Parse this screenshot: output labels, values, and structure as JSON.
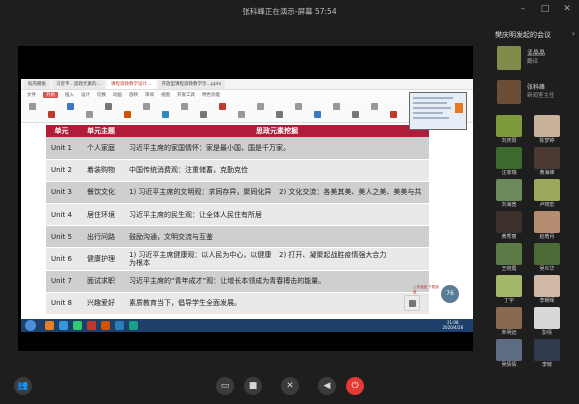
{
  "window": {
    "title": "张科峰正在演示-屏幕 57:54",
    "controls": [
      "minimize-icon",
      "maximize-icon",
      "close-icon"
    ]
  },
  "shared_screen": {
    "tabs": [
      {
        "label": "稻壳模板",
        "active": false
      },
      {
        "label": "习近平…思政元素的…",
        "active": false
      },
      {
        "label": "课程思政教学设计…",
        "active": true
      },
      {
        "label": "开放型课程思政教学示…pptx",
        "active": false
      }
    ],
    "menu": [
      "文件",
      "开始",
      "插入",
      "设计",
      "切换",
      "动画",
      "放映",
      "审阅",
      "视图",
      "开发工具",
      "特色功能"
    ],
    "active_menu": "开始",
    "table": {
      "headers": [
        "单元",
        "单元主题",
        "思政元素挖掘"
      ],
      "rows": [
        {
          "unit": "Unit 1",
          "topic": "个人家庭",
          "content": "习近平主席的家国情怀：家是最小国，国是千万家。",
          "content2": ""
        },
        {
          "unit": "Unit 2",
          "topic": "着装购物",
          "content": "中国传统消费观：注重储蓄，克勤克俭",
          "content2": ""
        },
        {
          "unit": "Unit 3",
          "topic": "餐饮文化",
          "content": "1) 习近平主席的文明观：求同存异，聚同化异",
          "content2": "2) 文化交流：各美其美、美人之美、美美与共"
        },
        {
          "unit": "Unit 4",
          "topic": "居住环境",
          "content": "习近平主席的民生观：让全体人民住有所居",
          "content2": ""
        },
        {
          "unit": "Unit 5",
          "topic": "出行问路",
          "content": "鼓励沟通，文明交流与互鉴",
          "content2": ""
        },
        {
          "unit": "Unit 6",
          "topic": "健康护理",
          "content": "1) 习近平主席健康观：以人民为中心，以健康为根本",
          "content2": "2) 打开、凝聚起战胜疫情强大合力"
        },
        {
          "unit": "Unit 7",
          "topic": "面试求职",
          "content": "习近平主席的“青年成才”观：让增长本领成为青春搏击的能量。",
          "content2": ""
        },
        {
          "unit": "Unit 8",
          "topic": "兴趣爱好",
          "content": "素质教育当下，倡导学生全面发展。",
          "content2": ""
        }
      ]
    },
    "network_widget": {
      "value": "76",
      "label": "上传速度 下载速度"
    },
    "clock": {
      "time": "21:08",
      "date": "2020/4/28"
    }
  },
  "participants_panel": {
    "title": "樊庆明发起的会议",
    "hosts": [
      {
        "name": "孟晶晶",
        "role": "翻译",
        "color": "#7f8c4c"
      },
      {
        "name": "张科峰",
        "role": "新闻室主任",
        "color": "#6b4e37"
      }
    ],
    "grid": [
      {
        "name": "刘庆阳",
        "color": "#7d9a3c"
      },
      {
        "name": "陈梦婷",
        "color": "#c9b29a"
      },
      {
        "name": "汪家瑞",
        "color": "#3a6a2c"
      },
      {
        "name": "黄海峰",
        "color": "#4a3a33"
      },
      {
        "name": "刘海宽",
        "color": "#6a8a59"
      },
      {
        "name": "卢晓宏",
        "color": "#9aa85b"
      },
      {
        "name": "黄秀丽",
        "color": "#3d2f2a"
      },
      {
        "name": "赵皓月",
        "color": "#b78d72"
      },
      {
        "name": "王晓霞",
        "color": "#5c7a45"
      },
      {
        "name": "吴炎华",
        "color": "#4d6a39"
      },
      {
        "name": "丁宇",
        "color": "#a4b86b"
      },
      {
        "name": "李朝晖",
        "color": "#d1b8a5"
      },
      {
        "name": "朱明远",
        "color": "#8a6a4e"
      },
      {
        "name": "彭倩",
        "color": "#d8d8d8"
      },
      {
        "name": "吴倩倩",
        "color": "#5d6b83"
      },
      {
        "name": "李敏",
        "color": "#2f3a4c"
      }
    ]
  },
  "bottom_controls": [
    {
      "name": "members-button",
      "icon": "people-icon",
      "glyph": "👥"
    },
    {
      "name": "share-screen-button",
      "icon": "screen-icon",
      "glyph": "▭"
    },
    {
      "name": "file-button",
      "icon": "folder-icon",
      "glyph": "■"
    },
    {
      "name": "mic-button",
      "icon": "mic-off-icon",
      "glyph": "✕"
    },
    {
      "name": "speaker-button",
      "icon": "speaker-icon",
      "glyph": "◀"
    },
    {
      "name": "leave-button",
      "icon": "power-icon",
      "glyph": "⏻"
    }
  ],
  "colors": {
    "header_red": "#b01d3a",
    "background": "#1e1e1e",
    "leave_red": "#e53935"
  }
}
